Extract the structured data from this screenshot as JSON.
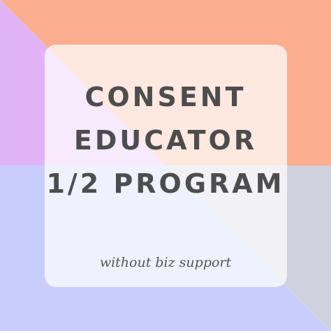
{
  "graphic": {
    "colors": {
      "top_right": "#fbae90",
      "top_left": "#e0b3f7",
      "bottom_left": "#c9cdfb",
      "bottom_right": "#cfd1de",
      "card": "#ffffff",
      "title_text": "#4d4d4d"
    },
    "title_lines": [
      "CONSENT",
      "EDUCATOR",
      "1/2 PROGRAM"
    ],
    "subtitle": "without biz support"
  }
}
